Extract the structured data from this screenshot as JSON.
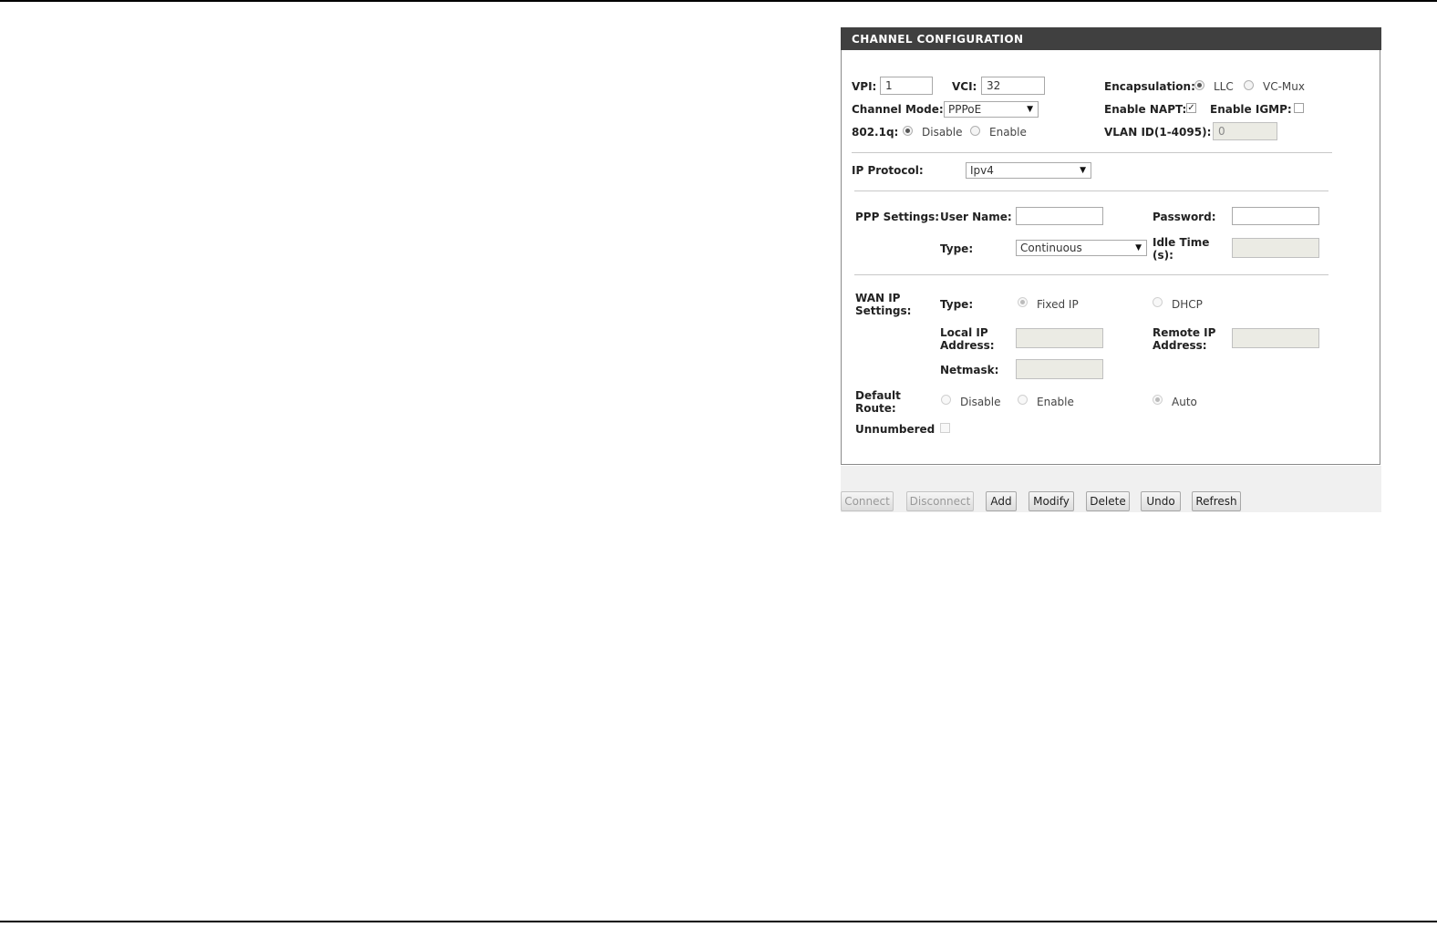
{
  "panel": {
    "title": "CHANNEL CONFIGURATION"
  },
  "vpi": {
    "label": "VPI:",
    "value": "1"
  },
  "vci": {
    "label": "VCI:",
    "value": "32"
  },
  "encapsulation": {
    "label": "Encapsulation:",
    "options": [
      "LLC",
      "VC-Mux"
    ],
    "selected": "LLC"
  },
  "channel_mode": {
    "label": "Channel Mode:",
    "value": "PPPoE"
  },
  "enable_napt": {
    "label": "Enable NAPT:",
    "checked": true
  },
  "enable_igmp": {
    "label": "Enable IGMP:",
    "checked": false
  },
  "dot1q": {
    "label": "802.1q:",
    "options": [
      "Disable",
      "Enable"
    ],
    "selected": "Disable"
  },
  "vlan_id": {
    "label": "VLAN ID(1-4095):",
    "value": "0"
  },
  "ip_protocol": {
    "label": "IP Protocol:",
    "value": "Ipv4"
  },
  "ppp": {
    "section_label": "PPP Settings:",
    "username_label": "User Name:",
    "username_value": "",
    "password_label": "Password:",
    "password_value": "",
    "type_label": "Type:",
    "type_value": "Continuous",
    "idle_label": "Idle Time (s):",
    "idle_value": ""
  },
  "wan": {
    "section_label": "WAN IP Settings:",
    "type_label": "Type:",
    "type_options": [
      "Fixed IP",
      "DHCP"
    ],
    "type_selected": "Fixed IP",
    "local_ip_label": "Local IP Address:",
    "local_ip_value": "",
    "remote_ip_label": "Remote IP Address:",
    "remote_ip_value": "",
    "netmask_label": "Netmask:",
    "netmask_value": ""
  },
  "default_route": {
    "label": "Default Route:",
    "options": [
      "Disable",
      "Enable",
      "Auto"
    ],
    "selected": "Auto"
  },
  "unnumbered": {
    "label": "Unnumbered",
    "checked": false
  },
  "buttons": {
    "connect": "Connect",
    "disconnect": "Disconnect",
    "add": "Add",
    "modify": "Modify",
    "delete": "Delete",
    "undo": "Undo",
    "refresh": "Refresh"
  }
}
